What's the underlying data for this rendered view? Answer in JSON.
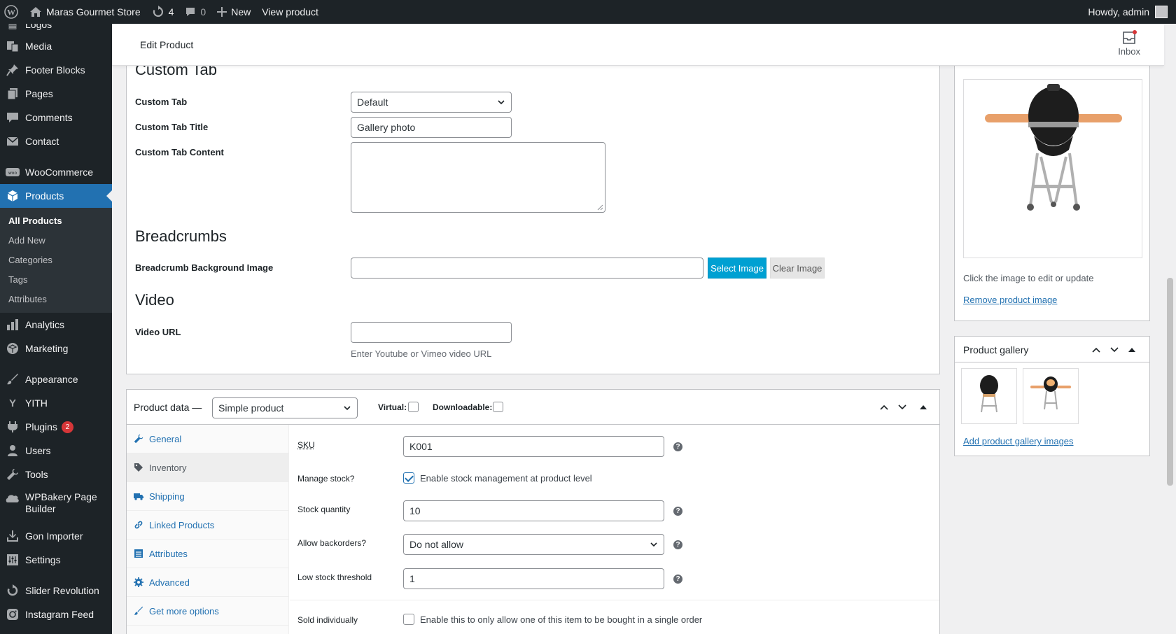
{
  "admin_bar": {
    "site_name": "Maras Gourmet Store",
    "updates_count": "4",
    "comments_count": "0",
    "new_label": "New",
    "view_label": "View product",
    "greeting": "Howdy, admin"
  },
  "sidebar": {
    "partial_top": "Logos",
    "items": {
      "media": "Media",
      "footer_blocks": "Footer Blocks",
      "pages": "Pages",
      "comments": "Comments",
      "contact": "Contact",
      "woocommerce": "WooCommerce",
      "products": "Products",
      "analytics": "Analytics",
      "marketing": "Marketing",
      "appearance": "Appearance",
      "yith": "YITH",
      "plugins": "Plugins",
      "plugins_badge": "2",
      "users": "Users",
      "tools": "Tools",
      "wpbakery": "WPBakery Page Builder",
      "gon_importer": "Gon Importer",
      "settings": "Settings",
      "slider_revolution": "Slider Revolution",
      "instagram_feed": "Instagram Feed"
    },
    "submenu": {
      "all_products": "All Products",
      "add_new": "Add New",
      "categories": "Categories",
      "tags": "Tags",
      "attributes": "Attributes"
    }
  },
  "header": {
    "title": "Edit Product",
    "inbox_label": "Inbox"
  },
  "custom_tab": {
    "section_title": "Custom Tab",
    "tab_label": "Custom Tab",
    "tab_value": "Default",
    "title_label": "Custom Tab Title",
    "title_value": "Gallery photo",
    "content_label": "Custom Tab Content"
  },
  "breadcrumbs": {
    "section_title": "Breadcrumbs",
    "bg_label": "Breadcrumb Background Image",
    "select_button": "Select Image",
    "clear_button": "Clear Image"
  },
  "video": {
    "section_title": "Video",
    "url_label": "Video URL",
    "hint": "Enter Youtube or Vimeo video URL"
  },
  "product_data": {
    "title": "Product data —",
    "type_value": "Simple product",
    "virtual_label": "Virtual:",
    "downloadable_label": "Downloadable:",
    "tabs": {
      "general": "General",
      "inventory": "Inventory",
      "shipping": "Shipping",
      "linked": "Linked Products",
      "attributes": "Attributes",
      "advanced": "Advanced",
      "more": "Get more options"
    },
    "sku_label": "SKU",
    "sku_value": "K001",
    "manage_stock_label": "Manage stock?",
    "manage_stock_text": "Enable stock management at product level",
    "stock_qty_label": "Stock quantity",
    "stock_qty_value": "10",
    "backorders_label": "Allow backorders?",
    "backorders_value": "Do not allow",
    "low_stock_label": "Low stock threshold",
    "low_stock_value": "1",
    "sold_individually_label": "Sold individually",
    "sold_individually_text": "Enable this to only allow one of this item to be bought in a single order"
  },
  "product_image": {
    "hint": "Click the image to edit or update",
    "remove_link": "Remove product image"
  },
  "gallery": {
    "title": "Product gallery",
    "add_link": "Add product gallery images"
  }
}
